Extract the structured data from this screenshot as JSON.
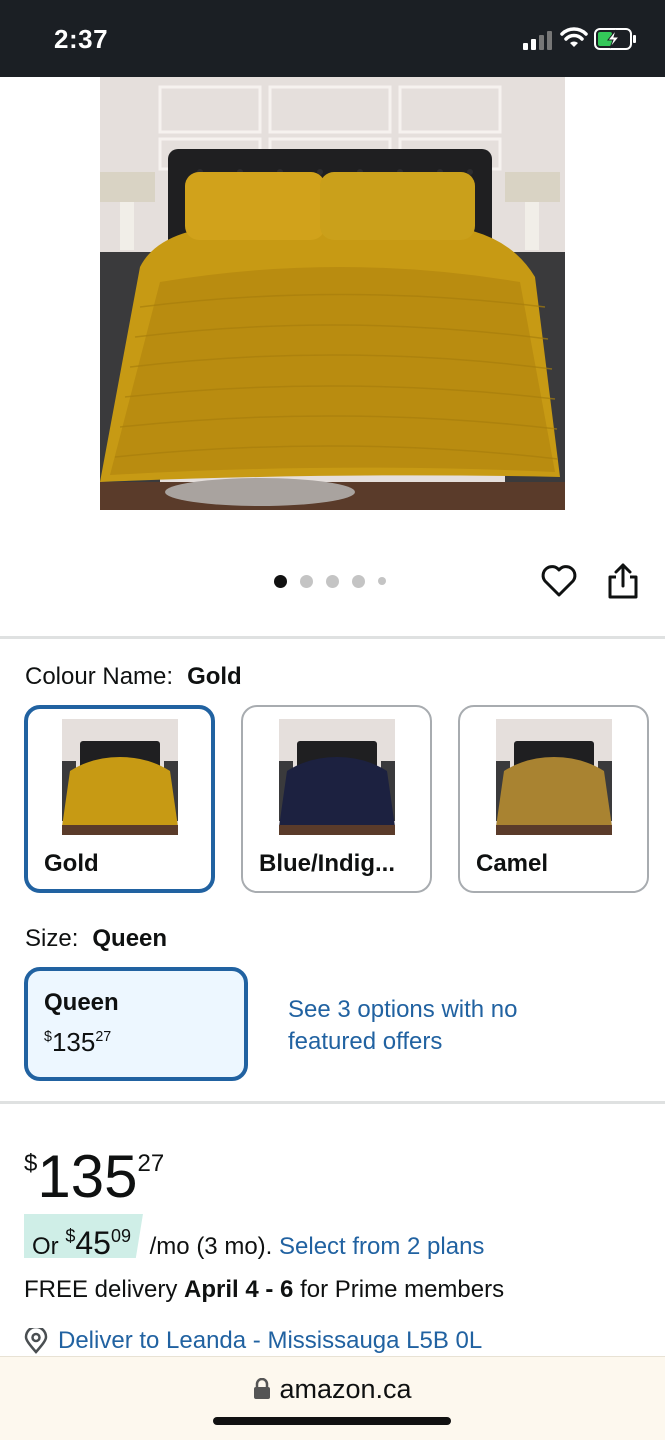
{
  "status_bar": {
    "time": "2:37"
  },
  "product": {
    "image_alt": "gold-velvet-quilt-bed",
    "carousel": {
      "total": 5,
      "active_index": 0
    }
  },
  "colour": {
    "label": "Colour Name:",
    "selected": "Gold",
    "options": [
      {
        "name": "Gold",
        "quilt_color": "#c79a14"
      },
      {
        "name": "Blue/Indig...",
        "quilt_color": "#1c2140"
      },
      {
        "name": "Camel",
        "quilt_color": "#a98331"
      }
    ]
  },
  "size": {
    "label": "Size:",
    "selected": "Queen",
    "option": {
      "name": "Queen",
      "currency": "$",
      "whole": "135",
      "fraction": "27"
    },
    "see_options": "See 3 options with no featured offers"
  },
  "price": {
    "currency": "$",
    "whole": "135",
    "fraction": "27"
  },
  "installment": {
    "prefix": "Or ",
    "currency": "$",
    "whole": "45",
    "fraction": "09",
    "suffix": " /mo (3 mo). ",
    "link": "Select from 2 plans"
  },
  "delivery": {
    "prefix": "FREE delivery ",
    "dates": "April 4 - 6",
    "suffix": " for Prime members"
  },
  "deliver_to": "Deliver to Leanda - Mississauga L5B 0L",
  "browser": {
    "url": "amazon.ca"
  },
  "colors": {
    "link": "#2162a1",
    "selected_border": "#2162a1",
    "installment_bg": "#cfeee7"
  }
}
